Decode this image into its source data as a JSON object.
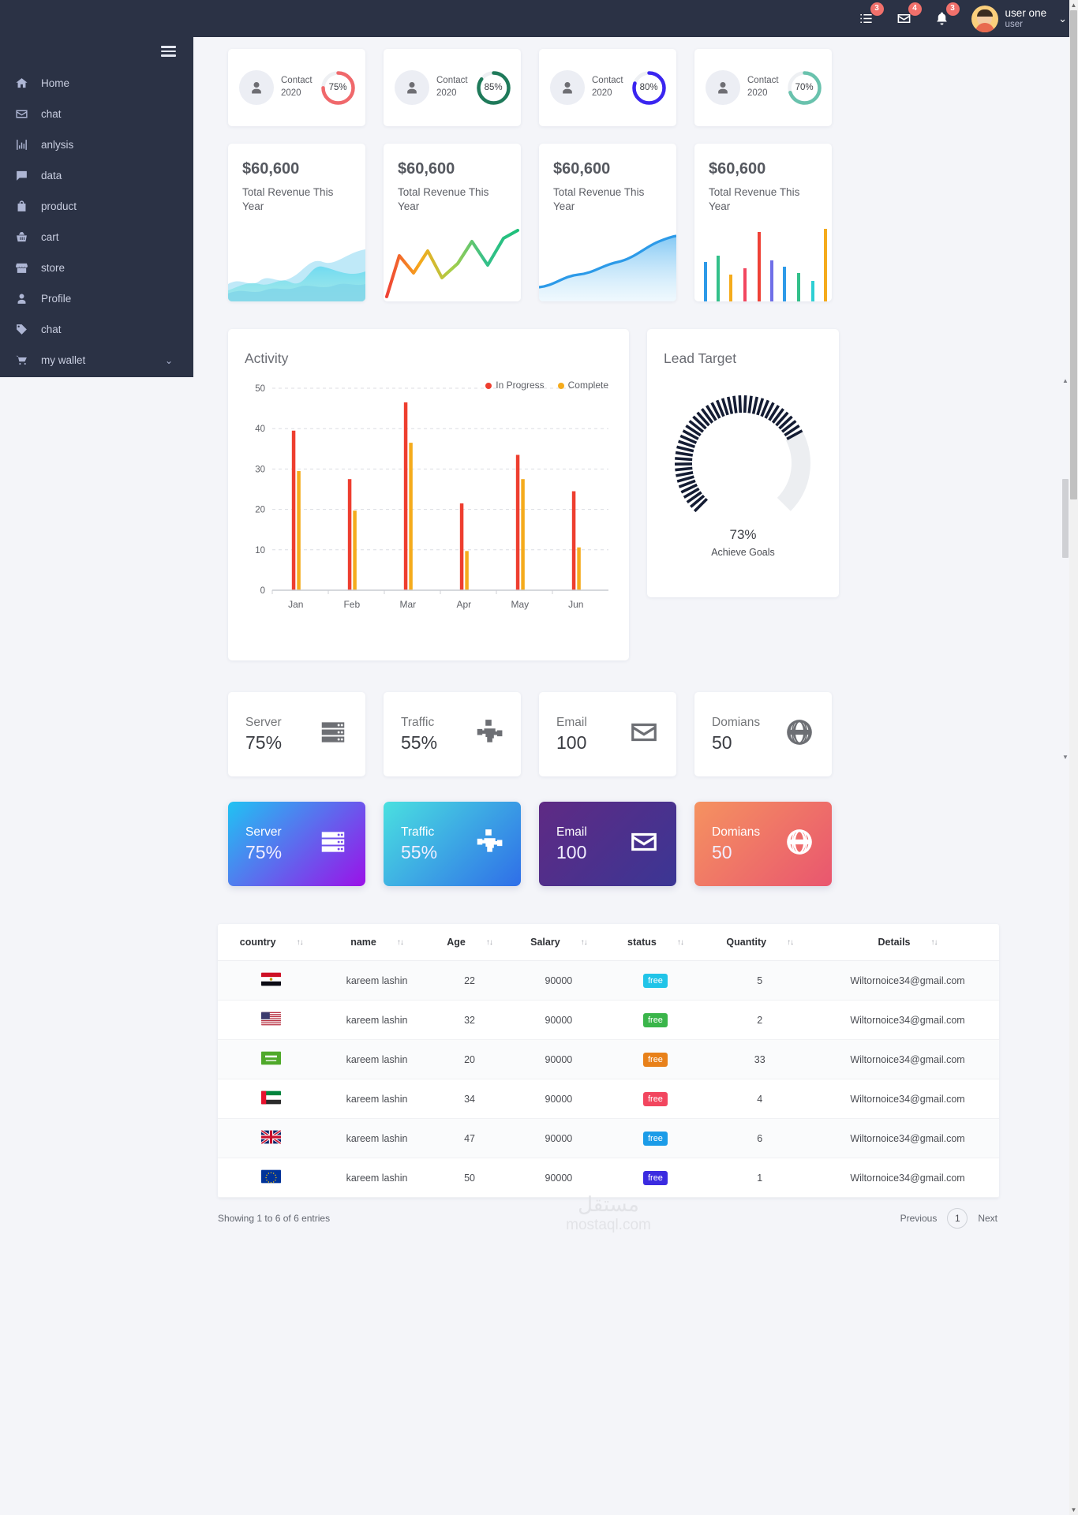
{
  "topbar": {
    "icons": [
      {
        "name": "tasks-icon",
        "badge": "3"
      },
      {
        "name": "envelope-icon",
        "badge": "4"
      },
      {
        "name": "bell-icon",
        "badge": "3"
      }
    ],
    "user_name": "user one",
    "user_role": "user",
    "caret": "⌄"
  },
  "sidebar": {
    "menu_icon": "hamburger-icon",
    "items": [
      {
        "label": "Home",
        "icon": "home-icon"
      },
      {
        "label": "chat",
        "icon": "envelope-icon"
      },
      {
        "label": "anlysis",
        "icon": "chart-bar-icon"
      },
      {
        "label": "data",
        "icon": "comment-icon"
      },
      {
        "label": "product",
        "icon": "bag-icon"
      },
      {
        "label": "cart",
        "icon": "basket-icon"
      },
      {
        "label": "store",
        "icon": "store-icon"
      },
      {
        "label": "Profile",
        "icon": "user-icon"
      },
      {
        "label": "chat",
        "icon": "tag-icon"
      },
      {
        "label": "my wallet",
        "icon": "shopping-cart-icon",
        "chevron": "⌄"
      }
    ]
  },
  "contact_cards": [
    {
      "title": "Contact",
      "year": "2020",
      "percent": "75%",
      "value": 75,
      "color": "#f0686b"
    },
    {
      "title": "Contact",
      "year": "2020",
      "percent": "85%",
      "value": 85,
      "color": "#1f7a5a"
    },
    {
      "title": "Contact",
      "year": "2020",
      "percent": "80%",
      "value": 80,
      "color": "#3a25f0"
    },
    {
      "title": "Contact",
      "year": "2020",
      "percent": "70%",
      "value": 70,
      "color": "#69c2ad"
    }
  ],
  "revenue_cards": [
    {
      "amount": "$60,600",
      "label": "Total Revenue This Year",
      "spark": "area-multi"
    },
    {
      "amount": "$60,600",
      "label": "Total Revenue This Year",
      "spark": "line-gradient"
    },
    {
      "amount": "$60,600",
      "label": "Total Revenue This Year",
      "spark": "area-blue"
    },
    {
      "amount": "$60,600",
      "label": "Total Revenue This Year",
      "spark": "bars-color"
    }
  ],
  "activity": {
    "title": "Activity",
    "legend": [
      {
        "label": "In Progress",
        "color": "#ee3e2f"
      },
      {
        "label": "Complete",
        "color": "#f5ab1c"
      }
    ]
  },
  "lead_target": {
    "title": "Lead Target",
    "percent": "73%",
    "value": 73,
    "subtitle": "Achieve Goals"
  },
  "stat_cards": [
    {
      "title": "Server",
      "value": "75%",
      "icon": "server-icon"
    },
    {
      "title": "Traffic",
      "value": "55%",
      "icon": "sitemap-icon"
    },
    {
      "title": "Email",
      "value": "100",
      "icon": "envelope-icon"
    },
    {
      "title": "Domians",
      "value": "50",
      "icon": "globe-icon"
    }
  ],
  "gradient_cards": [
    {
      "title": "Server",
      "value": "75%",
      "icon": "server-icon",
      "from": "#20c3f3",
      "to": "#9b11e8"
    },
    {
      "title": "Traffic",
      "value": "55%",
      "icon": "sitemap-icon",
      "from": "#4ae0e0",
      "to": "#2f6ee8"
    },
    {
      "title": "Email",
      "value": "100",
      "icon": "envelope-icon",
      "from": "#5f2a84",
      "to": "#3b3694"
    },
    {
      "title": "Domians",
      "value": "50",
      "icon": "globe-icon",
      "from": "#f59260",
      "to": "#e9566f"
    }
  ],
  "table": {
    "columns": [
      "country",
      "name",
      "Age",
      "Salary",
      "status",
      "Quantity",
      "Details"
    ],
    "sort_icon": "↑↓",
    "rows": [
      {
        "flag": "eg",
        "name": "kareem lashin",
        "age": "22",
        "salary": "90000",
        "status": "free",
        "status_color": "#21c4e8",
        "quantity": "5",
        "details": "Wiltornoice34@gmail.com"
      },
      {
        "flag": "us",
        "name": "kareem lashin",
        "age": "32",
        "salary": "90000",
        "status": "free",
        "status_color": "#3ab54a",
        "quantity": "2",
        "details": "Wiltornoice34@gmail.com"
      },
      {
        "flag": "sa",
        "name": "kareem lashin",
        "age": "20",
        "salary": "90000",
        "status": "free",
        "status_color": "#e8811a",
        "quantity": "33",
        "details": "Wiltornoice34@gmail.com"
      },
      {
        "flag": "ae",
        "name": "kareem lashin",
        "age": "34",
        "salary": "90000",
        "status": "free",
        "status_color": "#f2465f",
        "quantity": "4",
        "details": "Wiltornoice34@gmail.com"
      },
      {
        "flag": "gb",
        "name": "kareem lashin",
        "age": "47",
        "salary": "90000",
        "status": "free",
        "status_color": "#1b9ce8",
        "quantity": "6",
        "details": "Wiltornoice34@gmail.com"
      },
      {
        "flag": "eu",
        "name": "kareem lashin",
        "age": "50",
        "salary": "90000",
        "status": "free",
        "status_color": "#3b2be0",
        "quantity": "1",
        "details": "Wiltornoice34@gmail.com"
      }
    ],
    "showing": "Showing 1 to 6 of 6 entries",
    "previous": "Previous",
    "page": "1",
    "next": "Next"
  },
  "watermark": {
    "arabic": "مستقل",
    "latin": "mostaql.com"
  },
  "chart_data": {
    "type": "bar",
    "title": "Activity",
    "categories": [
      "Jan",
      "Feb",
      "Mar",
      "Apr",
      "May",
      "Jun"
    ],
    "series": [
      {
        "name": "In Progress",
        "color": "#ee3e2f",
        "values": [
          39.5,
          27.5,
          46.5,
          21.5,
          33.5,
          24.5
        ]
      },
      {
        "name": "Complete",
        "color": "#f5ab1c",
        "values": [
          29.5,
          19.7,
          36.5,
          9.7,
          27.5,
          10.6
        ]
      }
    ],
    "xlabel": "",
    "ylabel": "",
    "ylim": [
      0,
      50
    ],
    "yticks": [
      0,
      10,
      20,
      30,
      40,
      50
    ],
    "grid": true,
    "legend_position": "top-right"
  }
}
